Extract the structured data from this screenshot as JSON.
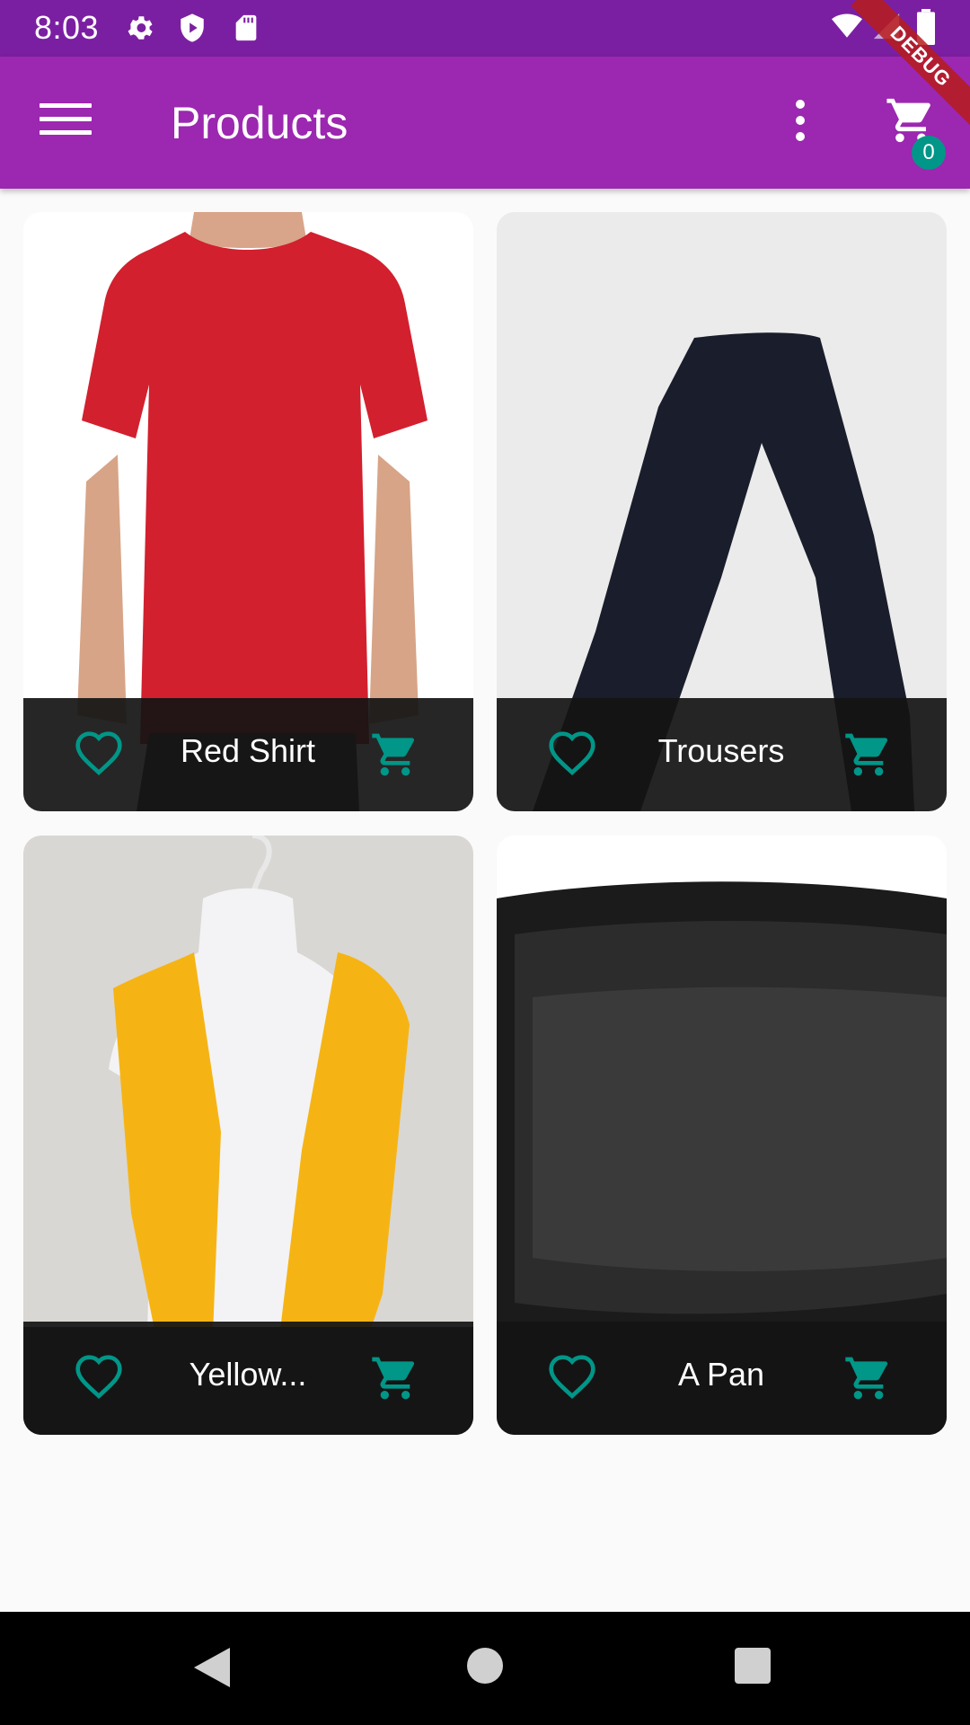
{
  "status_bar": {
    "time": "8:03",
    "icons": [
      "gear-icon",
      "shield-icon",
      "sd-card-icon",
      "wifi-icon",
      "signal-icon",
      "battery-icon"
    ]
  },
  "app_bar": {
    "title": "Products",
    "cart_count": "0",
    "debug_label": "DEBUG",
    "color": "#9c27b0",
    "status_color": "#7b1fa2"
  },
  "products": [
    {
      "title": "Red Shirt",
      "image": "red-shirt-photo"
    },
    {
      "title": "Trousers",
      "image": "trousers-photo"
    },
    {
      "title": "Yellow...",
      "image": "yellow-scarf-photo"
    },
    {
      "title": "A Pan",
      "image": "pan-photo"
    }
  ],
  "colors": {
    "accent": "#009688",
    "footer": "#141414"
  },
  "nav_bar": {
    "icons": [
      "back-icon",
      "home-icon",
      "recents-icon"
    ]
  }
}
